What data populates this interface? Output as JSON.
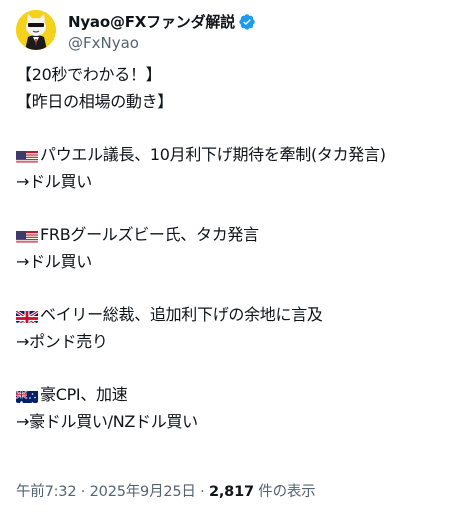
{
  "header": {
    "display_name": "Nyao@FXファンダ解説",
    "handle": "@FxNyao",
    "verified_color": "#1d9bf0"
  },
  "tweet": {
    "lines": {
      "l1": "【20秒でわかる！】",
      "l2": "【昨日の相場の動き】",
      "l3": "パウエル議長、10月利下げ期待を牽制(タカ発言)",
      "l4": "→ドル買い",
      "l5": "FRBグールズビー氏、タカ発言",
      "l6": "→ドル買い",
      "l7": "ベイリー総裁、追加利下げの余地に言及",
      "l8": "→ポンド売り",
      "l9": "豪CPI、加速",
      "l10": "→豪ドル買い/NZドル買い"
    },
    "flags": [
      "us-flag-icon",
      "us-flag-icon",
      "uk-flag-icon",
      "au-flag-icon"
    ]
  },
  "meta": {
    "time": "午前7:32",
    "separator": "·",
    "date": "2025年9月25日",
    "views_count": "2,817",
    "views_label": "件の表示"
  }
}
